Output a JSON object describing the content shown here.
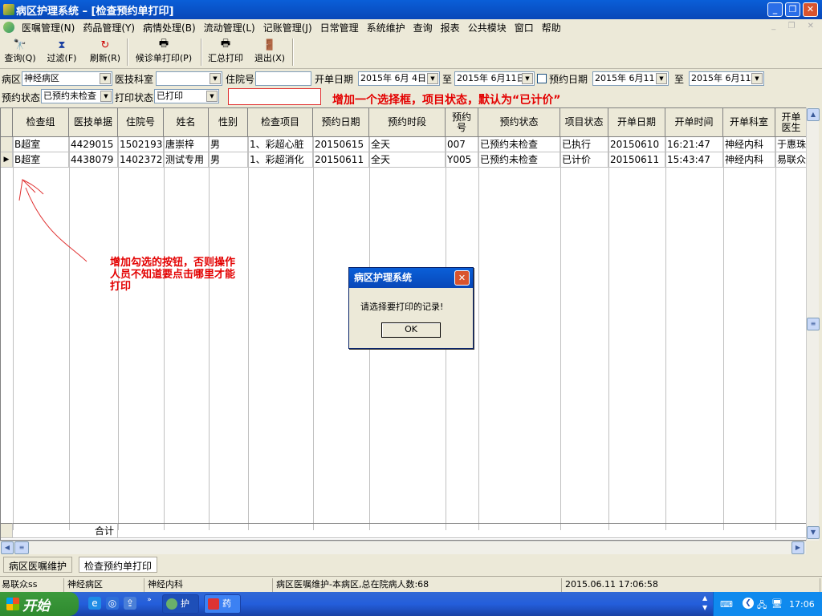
{
  "window": {
    "title": "病区护理系统 – [检查预约单打印]"
  },
  "menu": [
    "医嘱管理(N)",
    "药品管理(Y)",
    "病情处理(B)",
    "流动管理(L)",
    "记账管理(J)",
    "日常管理",
    "系统维护",
    "查询",
    "报表",
    "公共模块",
    "窗口",
    "帮助"
  ],
  "toolbar": {
    "query": "查询(Q)",
    "filter": "过滤(F)",
    "refresh": "刷新(R)",
    "print_followup": "候诊单打印(P)",
    "print_summary": "汇总打印",
    "exit": "退出(X)"
  },
  "filters": {
    "ward_label": "病区",
    "ward_value": "神经病区",
    "tech_dept_label": "医技科室",
    "tech_dept_value": "",
    "inpatient_label": "住院号",
    "inpatient_value": "",
    "open_date_label": "开单日期",
    "open_date_from": "2015年 6月 4日",
    "to_label": "至",
    "open_date_to": "2015年 6月11日",
    "appt_date_label": "预约日期",
    "appt_date_from": "2015年 6月11日",
    "appt_date_to": "2015年 6月11日",
    "appt_status_label": "预约状态",
    "appt_status_value": "已预约未检查",
    "print_status_label": "打印状态",
    "print_status_value": "已打印",
    "annotation": "增加一个选择框，项目状态，默认为“已计价”"
  },
  "table": {
    "columns": [
      "检查组",
      "医技单据",
      "住院号",
      "姓名",
      "性别",
      "检查项目",
      "预约日期",
      "预约时段",
      "预约号",
      "预约状态",
      "项目状态",
      "开单日期",
      "开单时间",
      "开单科室",
      "开单医生"
    ],
    "rows": [
      [
        "B超室",
        "4429015",
        "1502193",
        "唐崇梓",
        "男",
        "1、彩超心脏",
        "20150615",
        "全天",
        "007",
        "已预约未检查",
        "已执行",
        "20150610",
        "16:21:47",
        "神经内科",
        "于惠珠"
      ],
      [
        "B超室",
        "4438079",
        "1402372",
        "测试专用",
        "男",
        "1、彩超消化",
        "20150611",
        "全天",
        "Y005",
        "已预约未检查",
        "已计价",
        "20150611",
        "15:43:47",
        "神经内科",
        "易联众"
      ]
    ],
    "total_label": "合计"
  },
  "grid_annotation": "增加勾选的按钮，否则操作人员不知道要点击哪里才能打印",
  "dialog": {
    "title": "病区护理系统",
    "message": "请选择要打印的记录!",
    "ok": "OK"
  },
  "tabs": [
    "病区医嘱维护",
    "检查预约单打印"
  ],
  "status": {
    "user": "易联众ss",
    "ward": "神经病区",
    "dept": "神经内科",
    "info": "病区医嘱维护-本病区,总在院病人数:68",
    "datetime": "2015.06.11 17:06:58"
  },
  "taskbar": {
    "start": "开始",
    "task1": "护",
    "task2": "药",
    "clock": "17:06"
  }
}
